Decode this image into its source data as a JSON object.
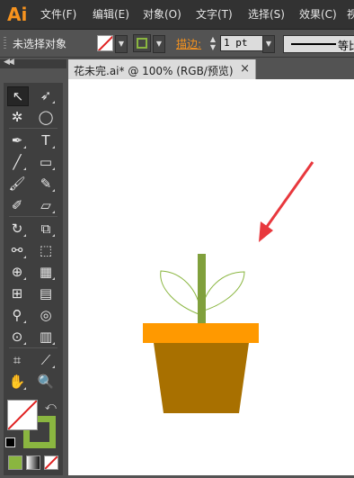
{
  "app": {
    "logo": "Ai"
  },
  "menu": [
    "文件(F)",
    "编辑(E)",
    "对象(O)",
    "文字(T)",
    "选择(S)",
    "效果(C)",
    "视"
  ],
  "controlbar": {
    "selection_label": "未选择对象",
    "stroke_label": "描边:",
    "stroke_weight": "1 pt",
    "profile_label": "等比"
  },
  "document_tab": {
    "title": "花未完.ai* @ 100% (RGB/预览)",
    "close": "×"
  },
  "colors": {
    "accent_orange": "#f7931e",
    "stroke_green": "#8ab640",
    "pot_rim": "#ff9900",
    "pot_body": "#a87000",
    "stem": "#80a03c",
    "leaf_outline": "#8ab640",
    "arrow": "#e8383d"
  },
  "tools": [
    "selection-tool",
    "direct-selection-tool",
    "magic-wand-tool",
    "lasso-tool",
    "pen-tool",
    "type-tool",
    "line-segment-tool",
    "rectangle-tool",
    "paintbrush-tool",
    "pencil-tool",
    "blob-brush-tool",
    "eraser-tool",
    "rotate-tool",
    "scale-tool",
    "width-tool",
    "free-transform-tool",
    "shape-builder-tool",
    "perspective-grid-tool",
    "mesh-tool",
    "gradient-tool",
    "eyedropper-tool",
    "blend-tool",
    "symbol-sprayer-tool",
    "column-graph-tool",
    "artboard-tool",
    "slice-tool",
    "hand-tool",
    "zoom-tool"
  ]
}
